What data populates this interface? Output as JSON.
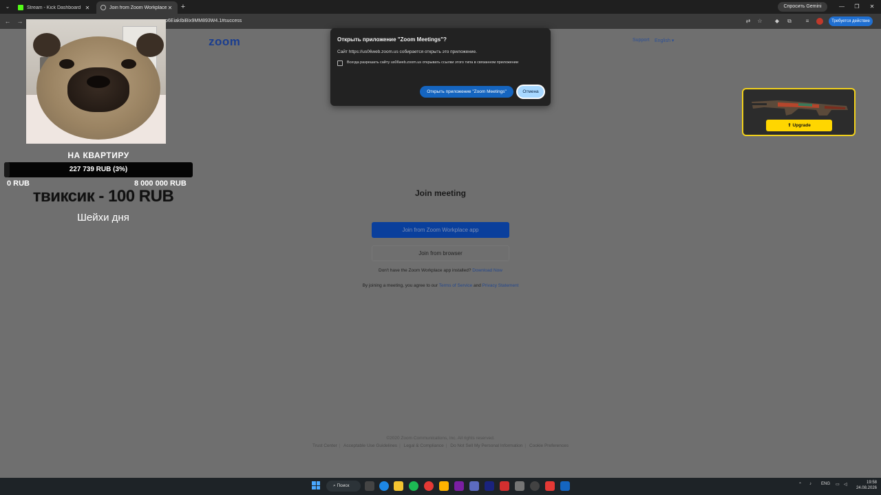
{
  "browser": {
    "tabs": [
      {
        "title": "Stream - Kick Dashboard",
        "active": false
      },
      {
        "title": "Join from Zoom Workplace app",
        "active": true
      }
    ],
    "url": "p6EiakIbiBix9MM893W4.1#success",
    "gemini_label": "Спросить Gemini",
    "update_label": "Требуется действие"
  },
  "zoom_page": {
    "logo": "zoom",
    "support_link": "Support",
    "language": "English",
    "title": "Join meeting",
    "join_app_button": "Join from Zoom Workplace app",
    "join_browser_button": "Join from browser",
    "hint_text": "Don't have the Zoom Workplace app installed?",
    "download_link": "Download Now",
    "terms_prefix": "By joining a meeting, you agree to our",
    "terms_link": "Terms of Service",
    "terms_and": "and",
    "privacy_link": "Privacy Statement",
    "copyright": "©2020 Zoom Communications, Inc. All rights reserved.",
    "footer_links": [
      "Trust Center",
      "Acceptable Use Guidelines",
      "Legal & Compliance",
      "Do Not Sell My Personal Information",
      "Cookie Preferences"
    ]
  },
  "dialog": {
    "title": "Открыть приложение \"Zoom Meetings\"?",
    "message": "Сайт https://us06web.zoom.us собирается открыть это приложение.",
    "checkbox_label": "Всегда разрешать сайту us06web.zoom.us открывать ссылки этого типа в связанном приложении",
    "open_button": "Открыть приложение \"Zoom Meetings\"",
    "cancel_button": "Отмена"
  },
  "overlay": {
    "goal_title": "НА КВАРТИРУ",
    "goal_progress_text": "227 739 RUB (3%)",
    "goal_progress": 0.03,
    "goal_min": "0 RUB",
    "goal_max": "8 000 000 RUB",
    "donation": "твиксик - 100 RUB",
    "shakes": "Шейхи дня"
  },
  "ad": {
    "upgrade_button": "⇑ Upgrade"
  },
  "taskbar": {
    "search_label": "Поиск",
    "lang": "ENG",
    "time": "19:58",
    "date": "24.08.2026"
  }
}
